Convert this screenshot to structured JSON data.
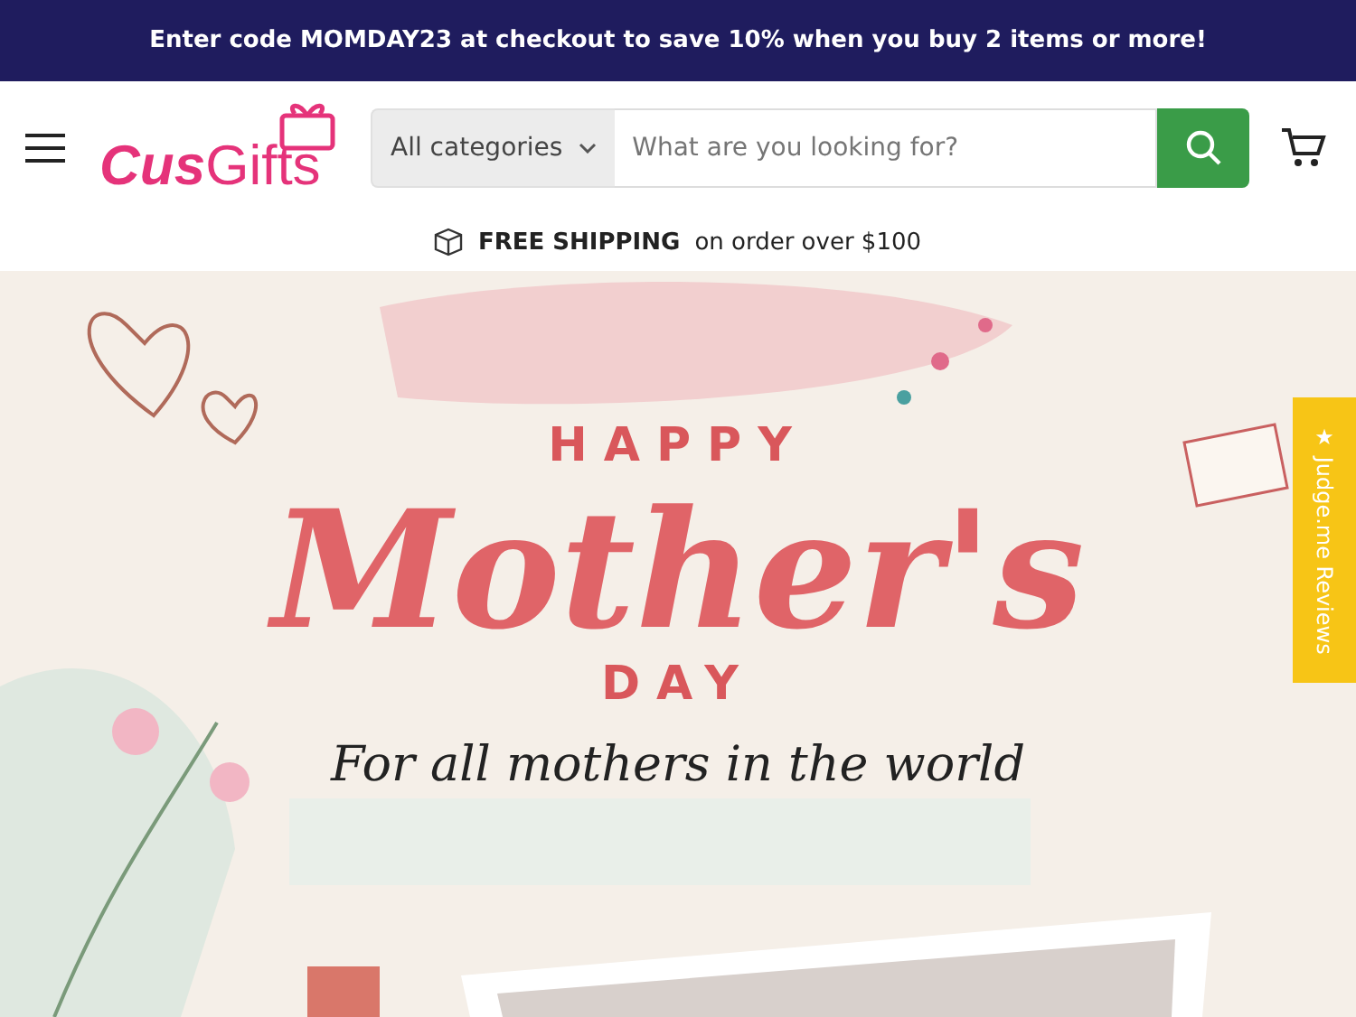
{
  "announcement": "Enter code MOMDAY23 at checkout to save 10% when you buy 2 items or more!",
  "logo": [
    "Cus",
    "Gifts"
  ],
  "search": {
    "category": "All categories",
    "placeholder": "What are you looking for?"
  },
  "shipping": {
    "title": "FREE SHIPPING",
    "text": "on order over $100"
  },
  "banner": {
    "line_1": "HAPPY",
    "line_2": "Mother's",
    "line_3": "DAY",
    "line_4": "For all mothers in the world"
  },
  "reviews_tab": "★ Judge.me Reviews"
}
